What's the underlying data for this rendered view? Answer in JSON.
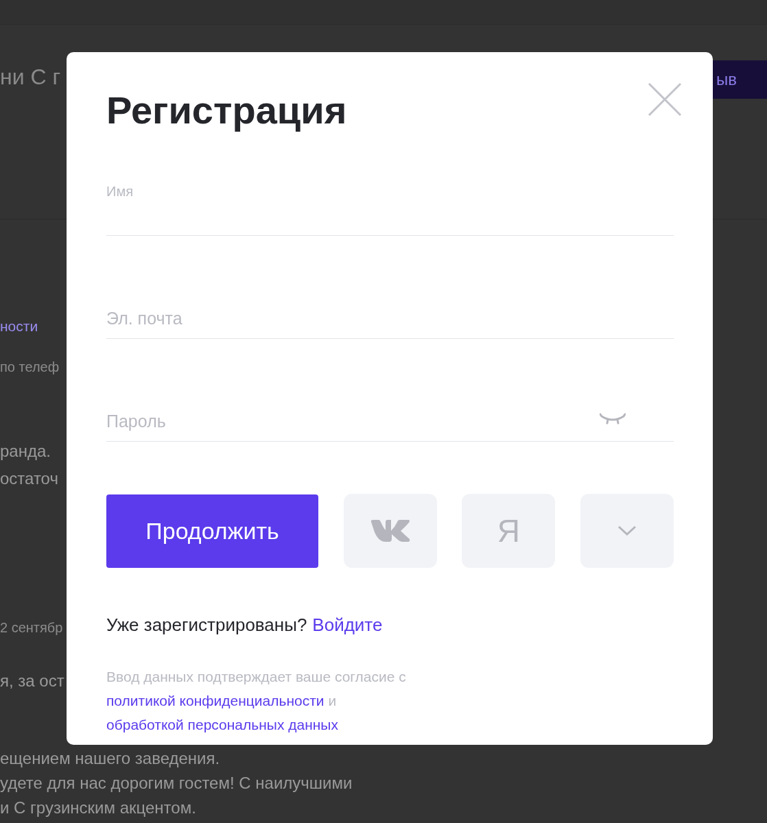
{
  "background_page": {
    "title": "ни С г",
    "header_button": "ыв",
    "link": "ности",
    "lines": [
      {
        "kind": "muted",
        "text": "по телеф"
      },
      {
        "kind": "body",
        "text": "ранда."
      },
      {
        "kind": "body",
        "text": "остаточ"
      },
      {
        "kind": "muted",
        "text": "2 сентябр"
      },
      {
        "kind": "body",
        "text": "я, за ост"
      },
      {
        "kind": "body",
        "text": "ещением нашего заведения."
      },
      {
        "kind": "body",
        "text": "удете для нас дорогим гостем! С наилучшими"
      },
      {
        "kind": "body",
        "text": "и С грузинским акцентом."
      }
    ]
  },
  "dialog": {
    "title": "Регистрация",
    "fields": [
      {
        "kind": "text",
        "label": "Имя",
        "floated": true
      },
      {
        "kind": "text",
        "label": "Эл. почта",
        "floated": false
      },
      {
        "kind": "password",
        "label": "Пароль",
        "floated": false
      }
    ],
    "submit_button": "Продолжить",
    "social_buttons": [
      {
        "kind": "vk"
      },
      {
        "kind": "letter",
        "text": "Я"
      },
      {
        "kind": "more"
      }
    ],
    "login_prompt": {
      "text": "Уже зарегистрированы?",
      "link": "Войдите"
    },
    "consent": {
      "text": "Ввод данных подтверждает ваше согласие с",
      "link_1": "политикой конфиденциальности",
      "joiner": "и",
      "link_2": "обработкой персональных данных"
    }
  }
}
